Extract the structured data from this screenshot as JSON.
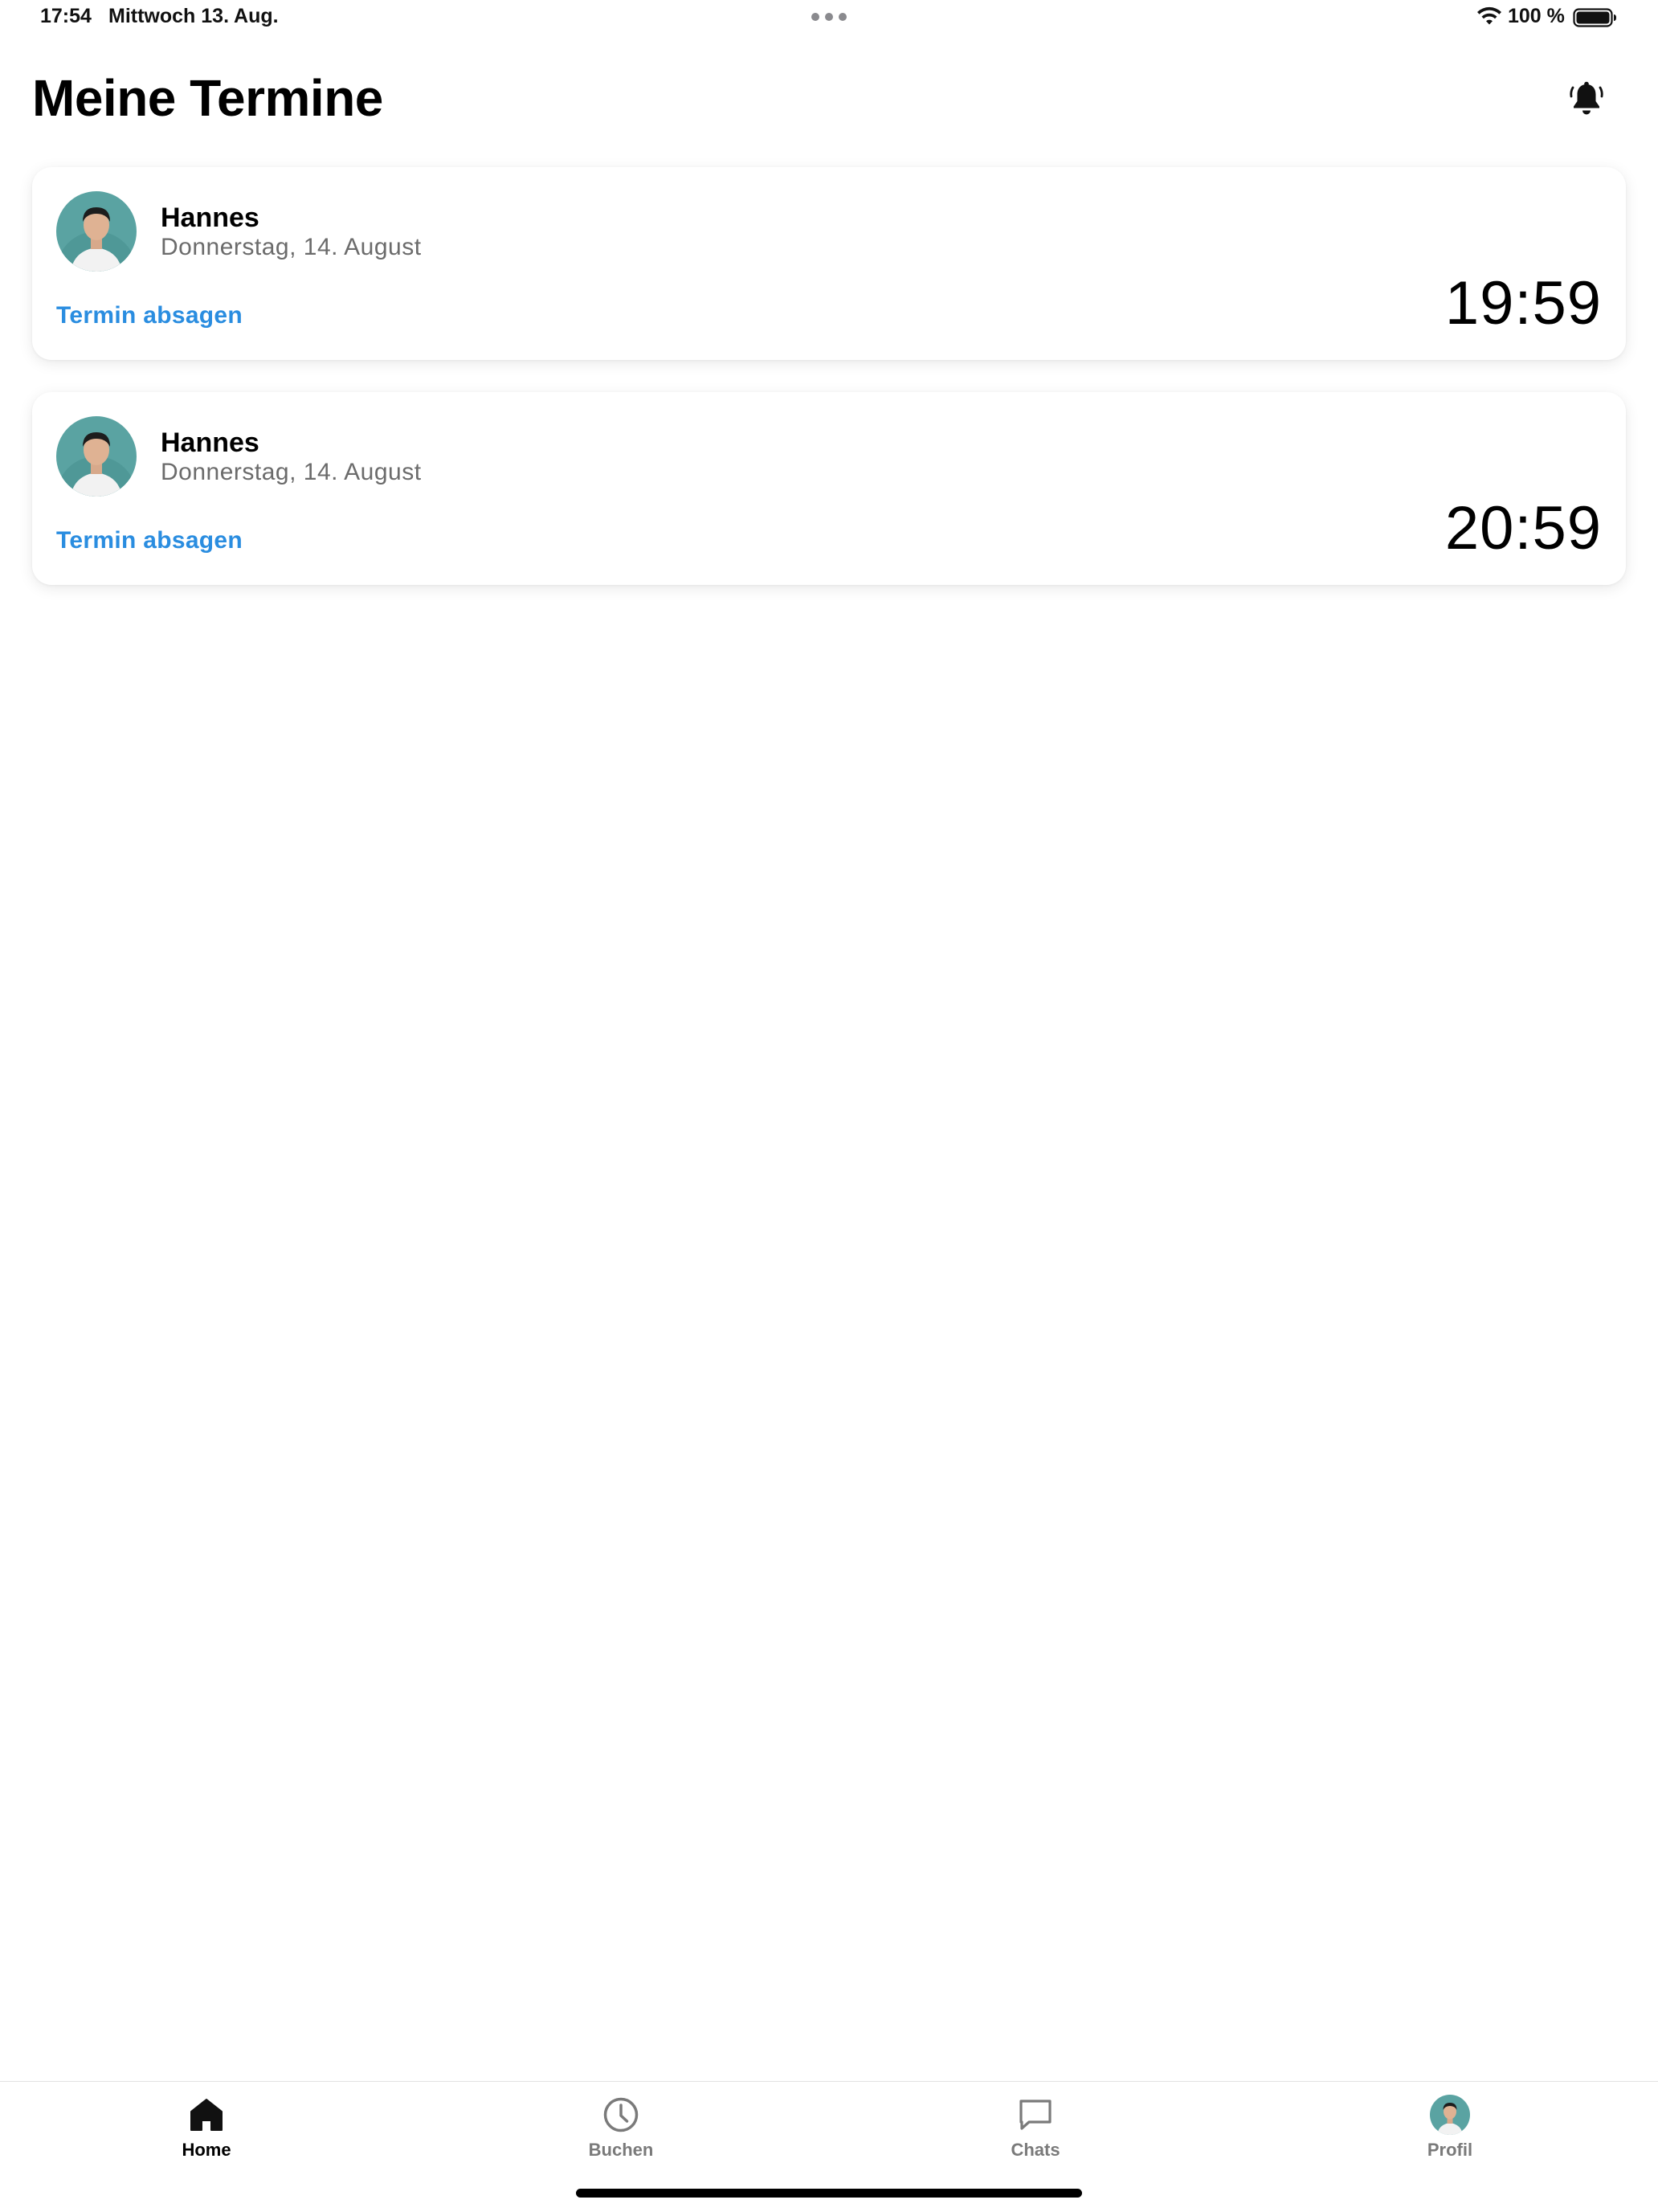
{
  "status_bar": {
    "time": "17:54",
    "date": "Mittwoch 13. Aug.",
    "battery": "100 %"
  },
  "header": {
    "title": "Meine Termine",
    "bell_icon": "bell-ring-icon"
  },
  "appointments": [
    {
      "name": "Hannes",
      "date": "Donnerstag, 14. August",
      "time": "19:59",
      "cancel_label": "Termin absagen"
    },
    {
      "name": "Hannes",
      "date": "Donnerstag, 14. August",
      "time": "20:59",
      "cancel_label": "Termin absagen"
    }
  ],
  "tab_bar": {
    "tabs": [
      {
        "label": "Home",
        "icon": "home-icon",
        "active": true
      },
      {
        "label": "Buchen",
        "icon": "clock-icon",
        "active": false
      },
      {
        "label": "Chats",
        "icon": "chat-bubble-icon",
        "active": false
      },
      {
        "label": "Profil",
        "icon": "avatar",
        "active": false
      }
    ]
  },
  "colors": {
    "accent": "#2a8de0",
    "secondary_text": "#6b6b6b",
    "inactive_tab": "#7a7a7a"
  }
}
